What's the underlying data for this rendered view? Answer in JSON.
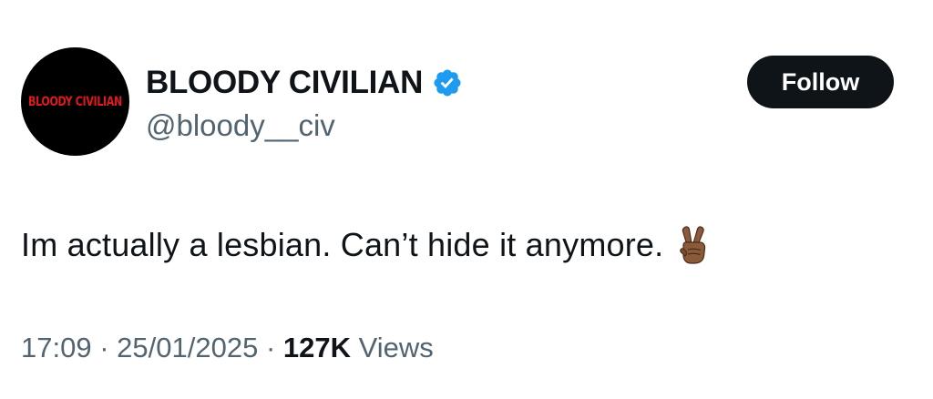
{
  "author": {
    "avatar_text": "BLOODY CIVILIAN",
    "avatar_bg": "#000000",
    "avatar_text_color": "#e0191e",
    "display_name": "BLOODY CIVILIAN",
    "handle": "@bloody__civ",
    "verified": true,
    "verified_icon": "verified-badge-icon",
    "verified_color": "#1d9bf0"
  },
  "follow_button": {
    "label": "Follow"
  },
  "tweet": {
    "text": "Im actually a lesbian. Can’t hide it anymore.",
    "emoji_icon": "victory-hand-medium-dark-skin-icon"
  },
  "meta": {
    "time": "17:09",
    "separator": "·",
    "date": "25/01/2025",
    "views_count": "127K",
    "views_label": "Views"
  },
  "colors": {
    "text_primary": "#0f1419",
    "text_secondary": "#536471",
    "button_bg": "#0f1419",
    "button_text": "#ffffff"
  }
}
